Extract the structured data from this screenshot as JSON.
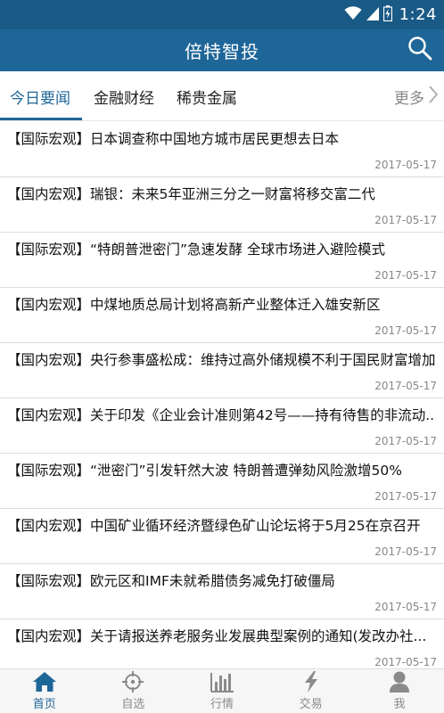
{
  "status_bar": {
    "time": "1:24"
  },
  "app_bar": {
    "title": "倍特智投"
  },
  "tabs": {
    "items": [
      {
        "label": "今日要闻",
        "active": true
      },
      {
        "label": "金融财经",
        "active": false
      },
      {
        "label": "稀贵金属",
        "active": false
      }
    ],
    "more_label": "更多"
  },
  "news": [
    {
      "title": "【国际宏观】日本调查称中国地方城市居民更想去日本",
      "date": "2017-05-17"
    },
    {
      "title": "【国内宏观】瑞银：未来5年亚洲三分之一财富将移交富二代",
      "date": "2017-05-17"
    },
    {
      "title": "【国际宏观】“特朗普泄密门”急速发酵 全球市场进入避险模式",
      "date": "2017-05-17"
    },
    {
      "title": "【国内宏观】中煤地质总局计划将高新产业整体迁入雄安新区",
      "date": "2017-05-17"
    },
    {
      "title": "【国内宏观】央行参事盛松成：维持过高外储规模不利于国民财富增加",
      "date": "2017-05-17"
    },
    {
      "title": "【国内宏观】关于印发《企业会计准则第42号——持有待售的非流动..",
      "date": "2017-05-17"
    },
    {
      "title": "【国际宏观】“泄密门”引发轩然大波 特朗普遭弹劾风险激增50%",
      "date": "2017-05-17"
    },
    {
      "title": "【国内宏观】中国矿业循环经济暨绿色矿山论坛将于5月25在京召开",
      "date": "2017-05-17"
    },
    {
      "title": "【国际宏观】欧元区和IMF未就希腊债务减免打破僵局",
      "date": "2017-05-17"
    },
    {
      "title": "【国内宏观】关于请报送养老服务业发展典型案例的通知(发改办社...",
      "date": "2017-05-17"
    }
  ],
  "bottom_nav": [
    {
      "label": "首页",
      "icon": "home-icon",
      "active": true
    },
    {
      "label": "自选",
      "icon": "crosshair-icon",
      "active": false
    },
    {
      "label": "行情",
      "icon": "bar-chart-icon",
      "active": false
    },
    {
      "label": "交易",
      "icon": "lightning-icon",
      "active": false
    },
    {
      "label": "我",
      "icon": "user-icon",
      "active": false
    }
  ],
  "colors": {
    "primary": "#1f6698",
    "status_bar": "#1a5a86",
    "inactive": "#8a8a8a"
  }
}
